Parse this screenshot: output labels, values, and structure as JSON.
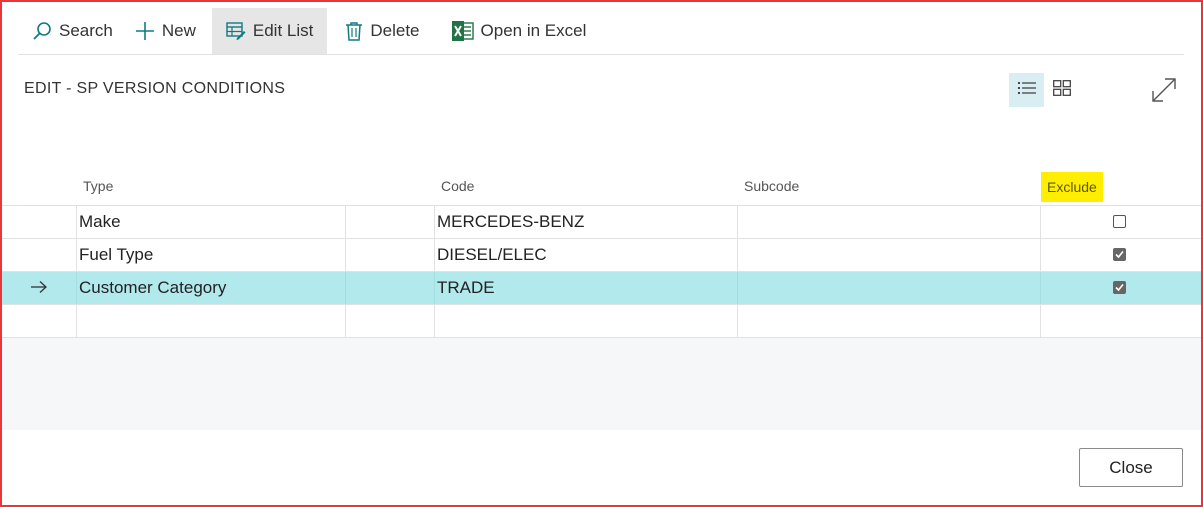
{
  "toolbar": {
    "search_label": "Search",
    "new_label": "New",
    "edit_list_label": "Edit List",
    "delete_label": "Delete",
    "open_excel_label": "Open in Excel"
  },
  "page": {
    "title": "EDIT - SP VERSION CONDITIONS"
  },
  "table": {
    "headers": {
      "type": "Type",
      "code": "Code",
      "subcode": "Subcode",
      "exclude": "Exclude"
    },
    "rows": [
      {
        "type": "Make",
        "code": "MERCEDES-BENZ",
        "subcode": "",
        "exclude": false
      },
      {
        "type": "Fuel Type",
        "code": "DIESEL/ELEC",
        "subcode": "",
        "exclude": true
      },
      {
        "type": "Customer Category",
        "code": "TRADE",
        "subcode": "",
        "exclude": true,
        "selected": true
      },
      {
        "type": "",
        "code": "",
        "subcode": "",
        "exclude": false
      }
    ]
  },
  "footer": {
    "close_label": "Close"
  },
  "colors": {
    "accent_teal": "#b2e9ec",
    "highlight_yellow": "#ffee00",
    "frame_red": "#e8363b",
    "excel_green": "#217346"
  }
}
